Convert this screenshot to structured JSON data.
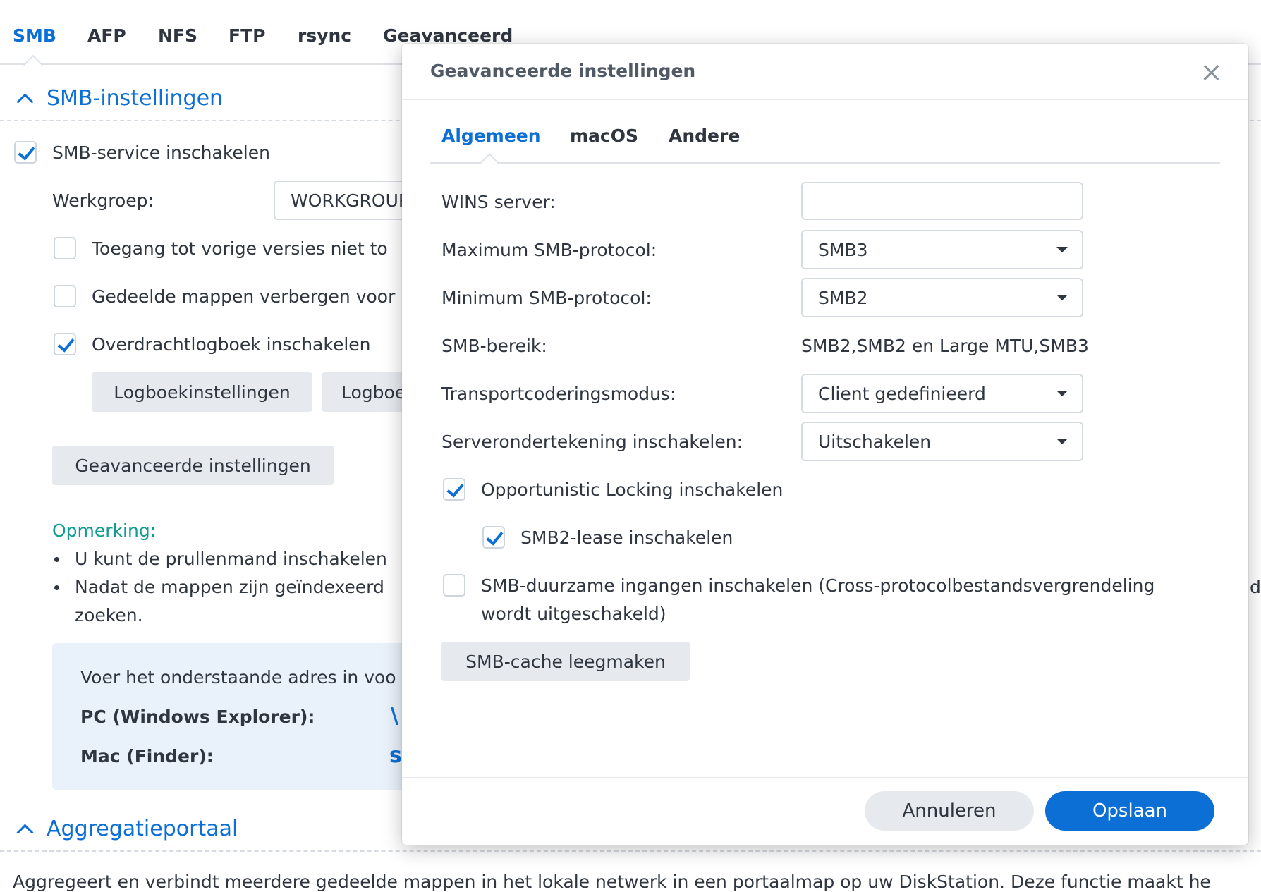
{
  "top_tabs": [
    "SMB",
    "AFP",
    "NFS",
    "FTP",
    "rsync",
    "Geavanceerd"
  ],
  "smb_section": {
    "title": "SMB-instellingen",
    "enable_service": {
      "label": "SMB-service inschakelen",
      "checked": true
    },
    "workgroup_label": "Werkgroep:",
    "workgroup_value": "WORKGROUP",
    "options": [
      {
        "label": "Toegang tot vorige versies niet to",
        "checked": false
      },
      {
        "label": "Gedeelde mappen verbergen voor",
        "checked": false
      },
      {
        "label": "Overdrachtlogboek inschakelen",
        "checked": true
      }
    ],
    "log_settings_button": "Logboekinstellingen",
    "log_button_partial": "Logboe",
    "advanced_button": "Geavanceerde instellingen",
    "note_label": "Opmerking:",
    "notes": [
      "U kunt de prullenmand inschakelen",
      "Nadat de mappen zijn geïndexeerd",
      "zoeken."
    ],
    "info": {
      "intro": "Voer het onderstaande adres in voo",
      "pc_label": "PC (Windows Explorer):",
      "pc_value": "\\",
      "mac_label": "Mac (Finder):",
      "mac_value": "s"
    }
  },
  "aggregation_section": {
    "title": "Aggregatieportaal",
    "description": "Aggregeert en verbindt meerdere gedeelde mappen in het lokale netwerk in een portaalmap op uw DiskStation. Deze functie maakt he"
  },
  "right_edge_fragment": "de",
  "dialog": {
    "title": "Geavanceerde instellingen",
    "tabs": [
      "Algemeen",
      "macOS",
      "Andere"
    ],
    "active_tab": "Algemeen",
    "wins_label": "WINS server:",
    "wins_value": "",
    "max_protocol": {
      "label": "Maximum SMB-protocol:",
      "value": "SMB3"
    },
    "min_protocol": {
      "label": "Minimum SMB-protocol:",
      "value": "SMB2"
    },
    "range": {
      "label": "SMB-bereik:",
      "value": "SMB2,SMB2 en Large MTU,SMB3"
    },
    "transport": {
      "label": "Transportcoderingsmodus:",
      "value": "Client gedefinieerd"
    },
    "signing": {
      "label": "Serverondertekening inschakelen:",
      "value": "Uitschakelen"
    },
    "oplock": {
      "label": "Opportunistic Locking inschakelen",
      "checked": true
    },
    "lease": {
      "label": "SMB2-lease inschakelen",
      "checked": true
    },
    "durable": {
      "label_line1": "SMB-duurzame ingangen inschakelen (Cross-protocolbestandsvergrendeling",
      "label_line2": "wordt uitgeschakeld)",
      "checked": false
    },
    "clear_cache_button": "SMB-cache leegmaken",
    "cancel_button": "Annuleren",
    "save_button": "Opslaan"
  }
}
